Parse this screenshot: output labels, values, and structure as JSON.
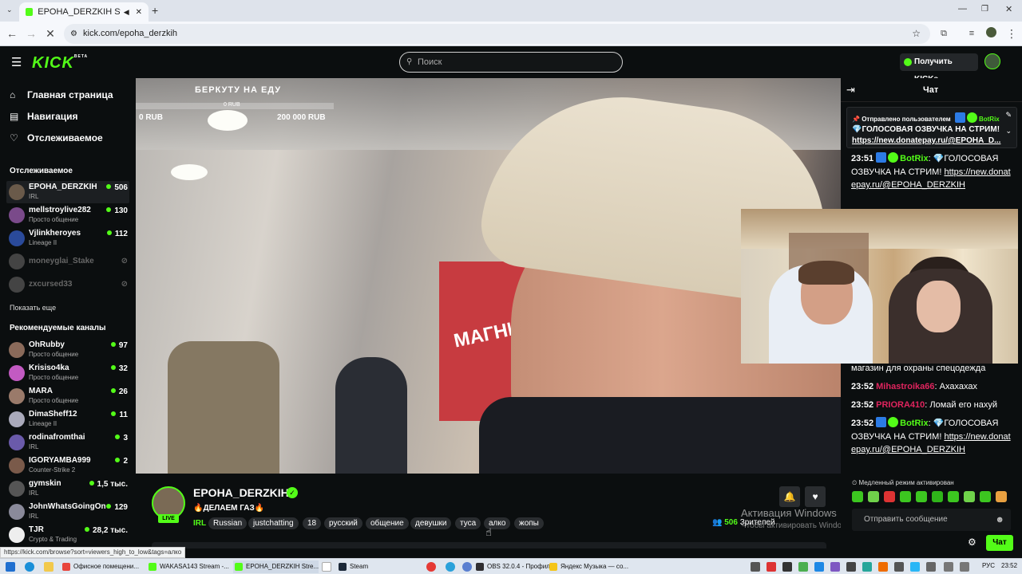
{
  "browser": {
    "active_tab_title": "EPOHA_DERZKIH Stream - ",
    "url": "kick.com/epoha_derzkih",
    "new_tab_icon": "plus-icon",
    "status_url": "https://kick.com/browse?sort=viewers_high_to_low&tags=алко"
  },
  "header": {
    "logo": "KICK",
    "logo_badge": "BETA",
    "search_placeholder": "Поиск",
    "get_kicks": "Получить KICKs"
  },
  "sidebar": {
    "nav": [
      {
        "label": "Главная страница",
        "icon": "home-icon"
      },
      {
        "label": "Навигация",
        "icon": "browse-icon"
      },
      {
        "label": "Отслеживаемое",
        "icon": "heart-icon"
      }
    ],
    "following_header": "Отслеживаемое",
    "following": [
      {
        "name": "EPOHA_DERZKIH",
        "category": "IRL",
        "viewers": "506",
        "live": true
      },
      {
        "name": "mellstroylive282",
        "category": "Просто общение",
        "viewers": "130",
        "live": true
      },
      {
        "name": "Vjlinkheroyes",
        "category": "Lineage II",
        "viewers": "112",
        "live": true
      },
      {
        "name": "moneyglai_Stake",
        "category": "",
        "viewers": "",
        "live": false
      },
      {
        "name": "zxcursed33",
        "category": "",
        "viewers": "",
        "live": false
      }
    ],
    "show_more": "Показать еще",
    "recommended_header": "Рекомендуемые каналы",
    "recommended": [
      {
        "name": "OhRubby",
        "category": "Просто общение",
        "viewers": "97"
      },
      {
        "name": "Krisiso4ka",
        "category": "Просто общение",
        "viewers": "32"
      },
      {
        "name": "MARA",
        "category": "Просто общение",
        "viewers": "26"
      },
      {
        "name": "DimaSheff12",
        "category": "Lineage II",
        "viewers": "11"
      },
      {
        "name": "rodinafromthai",
        "category": "IRL",
        "viewers": "3"
      },
      {
        "name": "IGORYAMBA999",
        "category": "Counter-Strike 2",
        "viewers": "2"
      },
      {
        "name": "gymskin",
        "category": "IRL",
        "viewers": "1,5 тыс."
      },
      {
        "name": "JohnWhatsGoingOn",
        "category": "IRL",
        "viewers": "129"
      },
      {
        "name": "TJR",
        "category": "Crypto & Trading",
        "viewers": "28,2 тыс."
      }
    ]
  },
  "video": {
    "donation_title": "БЕРКУТУ НА ЕДУ",
    "donation_current": "0 RUB",
    "donation_min": "0 RUB",
    "donation_max": "200 000 RUB",
    "donation_progress": 0,
    "store_sign": "МАГНИ"
  },
  "stream": {
    "name": "EPOHA_DERZKIH",
    "title": "🔥ДЕЛАЕМ ГАЗ🔥",
    "live_label": "LIVE",
    "category": "IRL",
    "tags": [
      "Russian",
      "justchatting",
      "18",
      "русский",
      "общение",
      "девушки",
      "туса",
      "алко",
      "жопы"
    ],
    "viewers_count": "506",
    "viewers_label": "Зрителей"
  },
  "os_watermark": {
    "title": "Активация Windows",
    "subtitle": "Чтобы активировать Windows, перейдите в раздел \"Параметры\"."
  },
  "chat": {
    "title": "Чат",
    "pinned_by": "Отправлено пользователем",
    "pinned_user": "BotRix",
    "pinned_message": "💎ГОЛОСОВАЯ ОЗВУЧКА НА СТРИМ!",
    "pinned_link": "https://new.donatepay.ru/@EPOHA_D...",
    "messages": [
      {
        "time": "23:51",
        "user": "BotRix",
        "user_color": "#53fc18",
        "text": "💎ГОЛОСОВАЯ ОЗВУЧКА НА СТРИМ!",
        "link": "https://new.donatepay.ru/@EPOHA_DERZKIH"
      },
      {
        "time": "",
        "user": "",
        "user_color": "#ffffff",
        "text": "магазин для охраны спецодежда",
        "link": ""
      },
      {
        "time": "23:52",
        "user": "Mihastroika66",
        "user_color": "#e0245e",
        "text": "Ахахахах",
        "link": ""
      },
      {
        "time": "23:52",
        "user": "PRIORA410",
        "user_color": "#e0245e",
        "text": "Ломай его нахуй",
        "link": ""
      },
      {
        "time": "23:52",
        "user": "BotRix",
        "user_color": "#53fc18",
        "text": "💎ГОЛОСОВАЯ ОЗВУЧКА НА СТРИМ!",
        "link": "https://new.donatepay.ru/@EPOHA_DERZKIH"
      }
    ],
    "slow_mode": "Медленный режим активирован",
    "input_placeholder": "Отправить сообщение",
    "send_label": "Чат"
  },
  "taskbar": {
    "items": [
      {
        "label": "Офисное помещени...",
        "color": "#e8453c"
      },
      {
        "label": "WAKASA143 Stream -...",
        "color": "#53fc18"
      },
      {
        "label": "EPOHA_DERZKIH Stre...",
        "color": "#53fc18"
      },
      {
        "label": "Steam",
        "color": "#1b2838"
      },
      {
        "label": "OBS 32.0.4 - Профил...",
        "color": "#302e31"
      },
      {
        "label": "Яндекс Музыка — со...",
        "color": "#f5c518"
      }
    ],
    "lang": "РУС",
    "time": "23:52"
  }
}
